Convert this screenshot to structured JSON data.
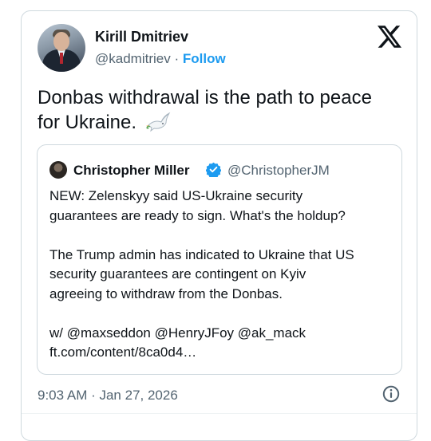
{
  "author": {
    "name": "Kirill Dmitriev",
    "handle": "@kadmitriev",
    "separator": "·",
    "follow_label": "Follow"
  },
  "tweet": {
    "text": "Donbas withdrawal is the path to peace for Ukraine.",
    "emoji": "dove"
  },
  "quoted_tweet": {
    "name": "Christopher Miller",
    "handle": "@ChristopherJM",
    "verified": true,
    "lines": [
      "NEW: Zelenskyy said US-Ukraine security",
      "guarantees are ready to sign. What's the holdup?",
      "",
      "The Trump admin has indicated to Ukraine that US",
      "security guarantees are contingent on Kyiv",
      "agreeing to withdraw from the Donbas.",
      "",
      "w/ @maxseddon @HenryJFoy @ak_mack",
      "ft.com/content/8ca0d4…"
    ]
  },
  "timestamp": "9:03 AM · Jan 27, 2026",
  "icons": [
    "x-logo-icon",
    "verified-badge-icon",
    "dove-icon",
    "info-icon"
  ],
  "colors": {
    "link": "#1d9bf0",
    "muted": "#536471",
    "border": "#cfd9de",
    "text": "#0f1419"
  }
}
